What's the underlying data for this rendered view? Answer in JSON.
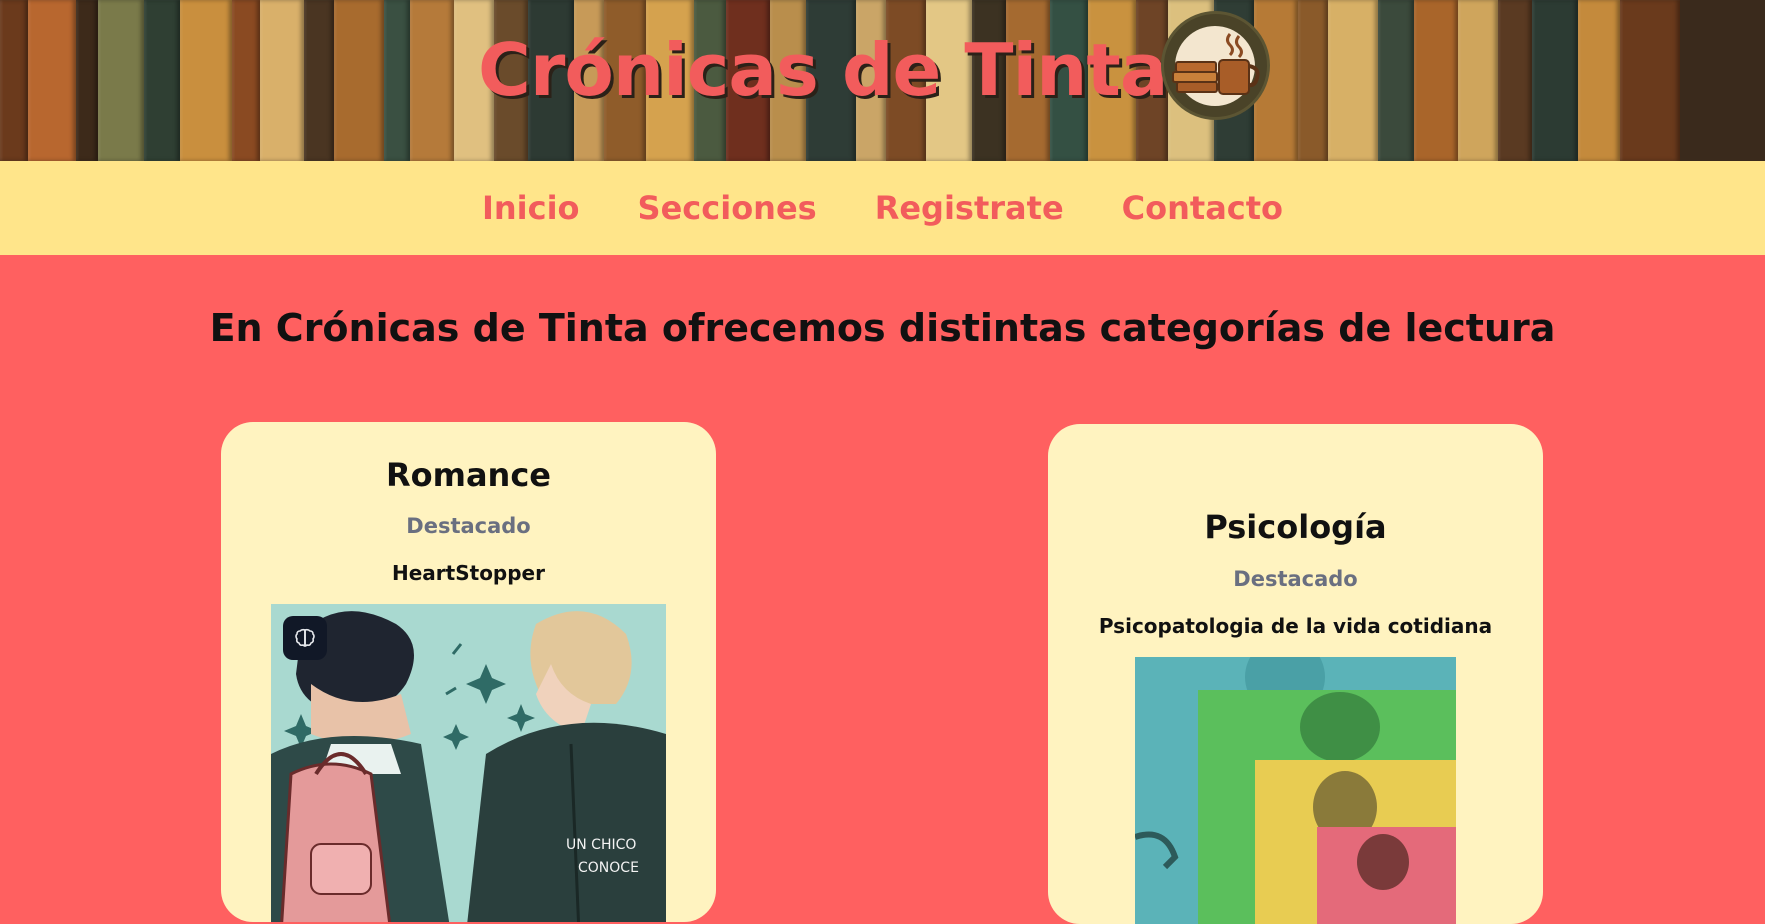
{
  "header": {
    "title": "Crónicas de Tinta",
    "logo_icon": "books-and-coffee-icon"
  },
  "nav": {
    "items": [
      {
        "label": "Inicio"
      },
      {
        "label": "Secciones"
      },
      {
        "label": "Registrate"
      },
      {
        "label": "Contacto"
      }
    ]
  },
  "main": {
    "intro": "En Crónicas de Tinta ofrecemos distintas categorías de lectura",
    "cards": [
      {
        "category": "Romance",
        "tag": "Destacado",
        "book": "HeartStopper",
        "cover_text": "UN CHICO\nCONOCE"
      },
      {
        "category": "Psicología",
        "tag": "Destacado",
        "book": "Psicopatologia de la vida cotidiana"
      }
    ]
  },
  "colors": {
    "accent": "#f25c5c",
    "nav_bg": "#ffe58a",
    "page_bg": "#ff6060",
    "card_bg": "#fff3c0"
  }
}
